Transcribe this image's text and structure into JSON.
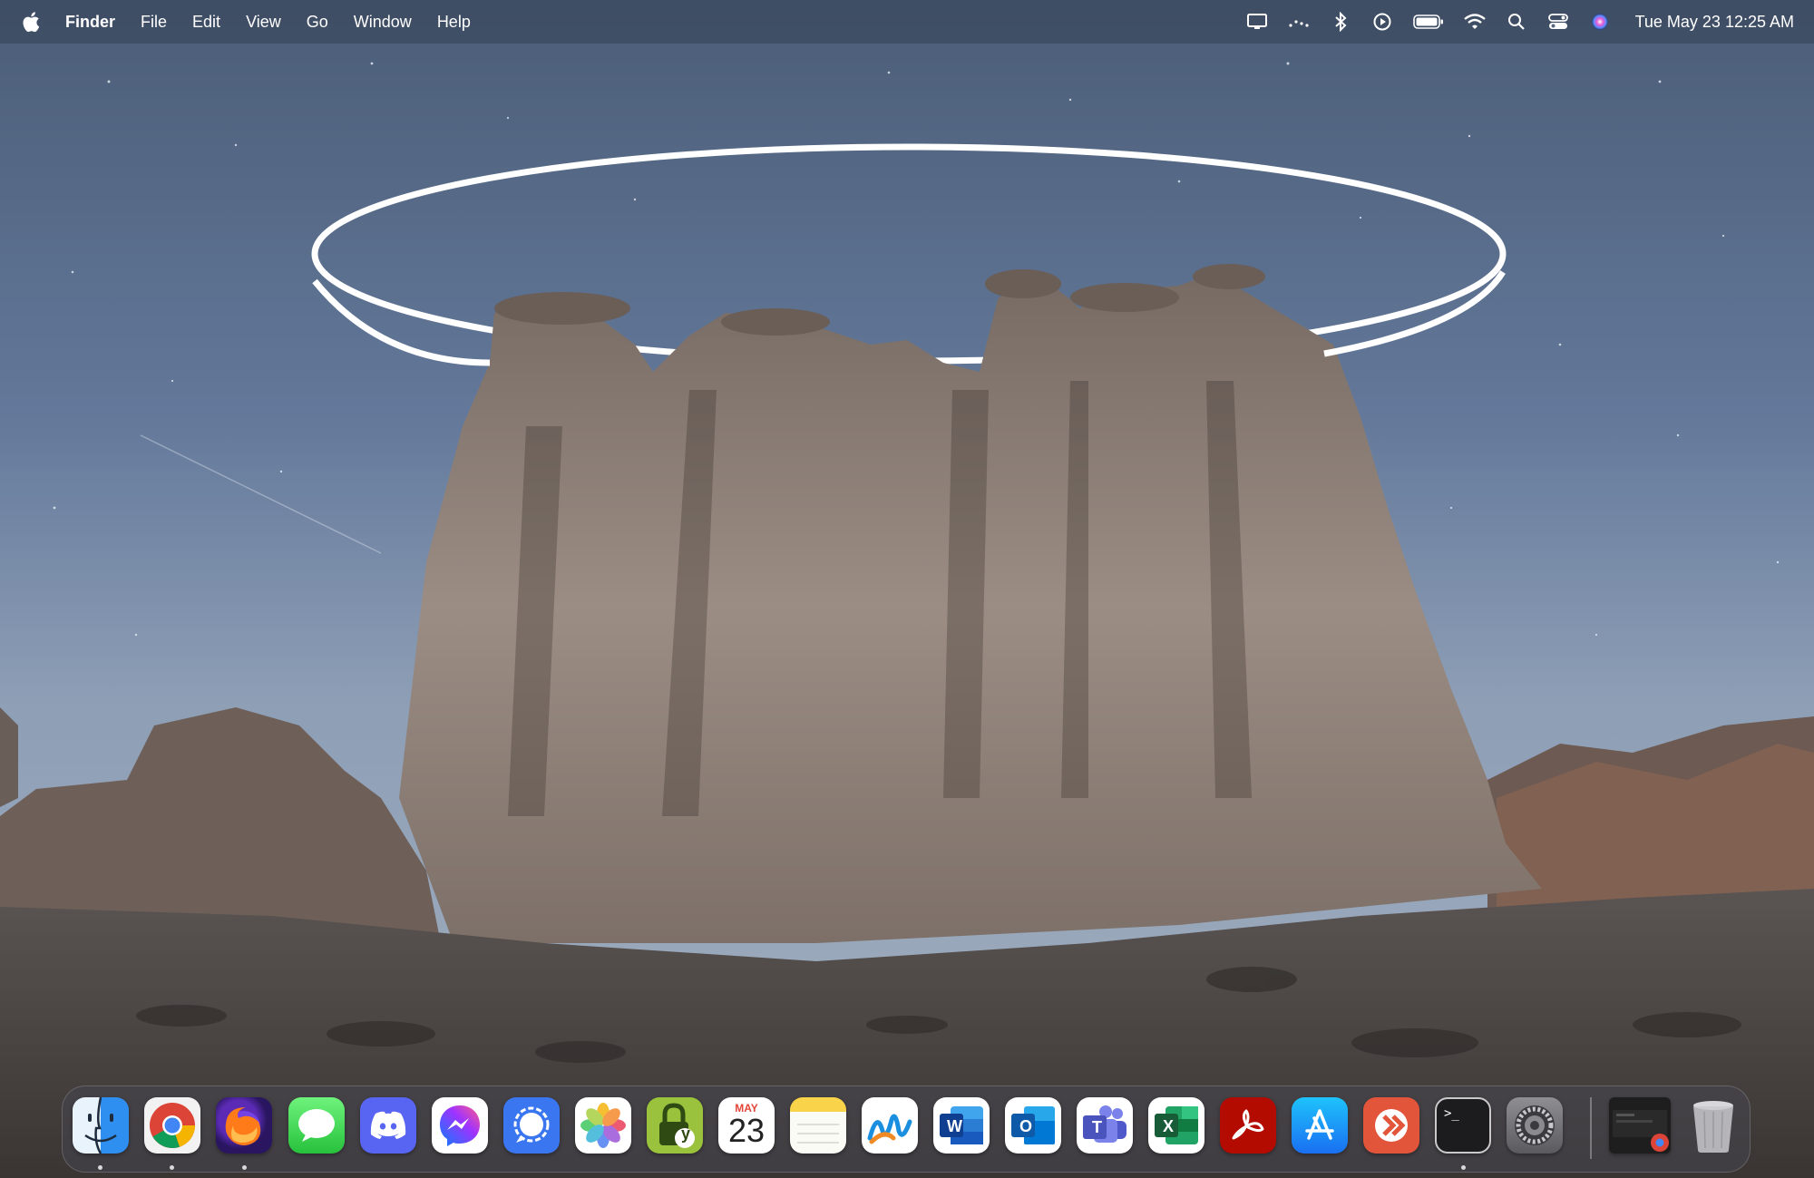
{
  "menubar": {
    "app_name": "Finder",
    "menus": [
      "File",
      "Edit",
      "View",
      "Go",
      "Window",
      "Help"
    ],
    "clock": "Tue May 23  12:25 AM"
  },
  "status_icons": [
    "display-icon",
    "weather-dots-icon",
    "bluetooth-icon",
    "play-circle-icon",
    "battery-icon",
    "wifi-icon",
    "spotlight-search-icon",
    "control-center-icon",
    "siri-icon"
  ],
  "dock": {
    "apps": [
      {
        "name": "Finder",
        "icon": "finder-icon",
        "running": true
      },
      {
        "name": "Google Chrome",
        "icon": "chrome-icon",
        "running": true
      },
      {
        "name": "Firefox",
        "icon": "firefox-icon",
        "running": true
      },
      {
        "name": "Messages",
        "icon": "messages-icon",
        "running": false
      },
      {
        "name": "Discord",
        "icon": "discord-icon",
        "running": false
      },
      {
        "name": "Messenger",
        "icon": "messenger-icon",
        "running": false
      },
      {
        "name": "Signal",
        "icon": "signal-icon",
        "running": false
      },
      {
        "name": "Photos",
        "icon": "photos-icon",
        "running": false
      },
      {
        "name": "Yubico Authenticator",
        "icon": "lock-y-icon",
        "running": false
      },
      {
        "name": "Calendar",
        "icon": "calendar-icon",
        "running": false
      },
      {
        "name": "Notes",
        "icon": "notes-icon",
        "running": false
      },
      {
        "name": "Freeform",
        "icon": "freeform-icon",
        "running": false
      },
      {
        "name": "Microsoft Word",
        "icon": "word-icon",
        "running": false
      },
      {
        "name": "Microsoft Outlook",
        "icon": "outlook-icon",
        "running": false
      },
      {
        "name": "Microsoft Teams",
        "icon": "teams-icon",
        "running": false
      },
      {
        "name": "Microsoft Excel",
        "icon": "excel-icon",
        "running": false
      },
      {
        "name": "Adobe Acrobat",
        "icon": "acrobat-icon",
        "running": false
      },
      {
        "name": "App Store",
        "icon": "app-store-icon",
        "running": false
      },
      {
        "name": "Remote Desktop",
        "icon": "remote-desktop-icon",
        "running": false
      },
      {
        "name": "Terminal",
        "icon": "terminal-icon",
        "running": true
      },
      {
        "name": "System Settings",
        "icon": "settings-gear-icon",
        "running": false
      }
    ],
    "calendar_month": "MAY",
    "calendar_day": "23",
    "word_letter": "W",
    "outlook_letter": "O",
    "teams_letter": "T",
    "excel_letter": "X",
    "yubico_letter": "y",
    "terminal_prompt": ">_",
    "recent_item": "chrome-window-thumbnail",
    "trash": "trash-icon"
  },
  "colors": {
    "menubar_bg": "#344256",
    "sky_top": "#4d5f78",
    "rock": "#8a7d74"
  }
}
